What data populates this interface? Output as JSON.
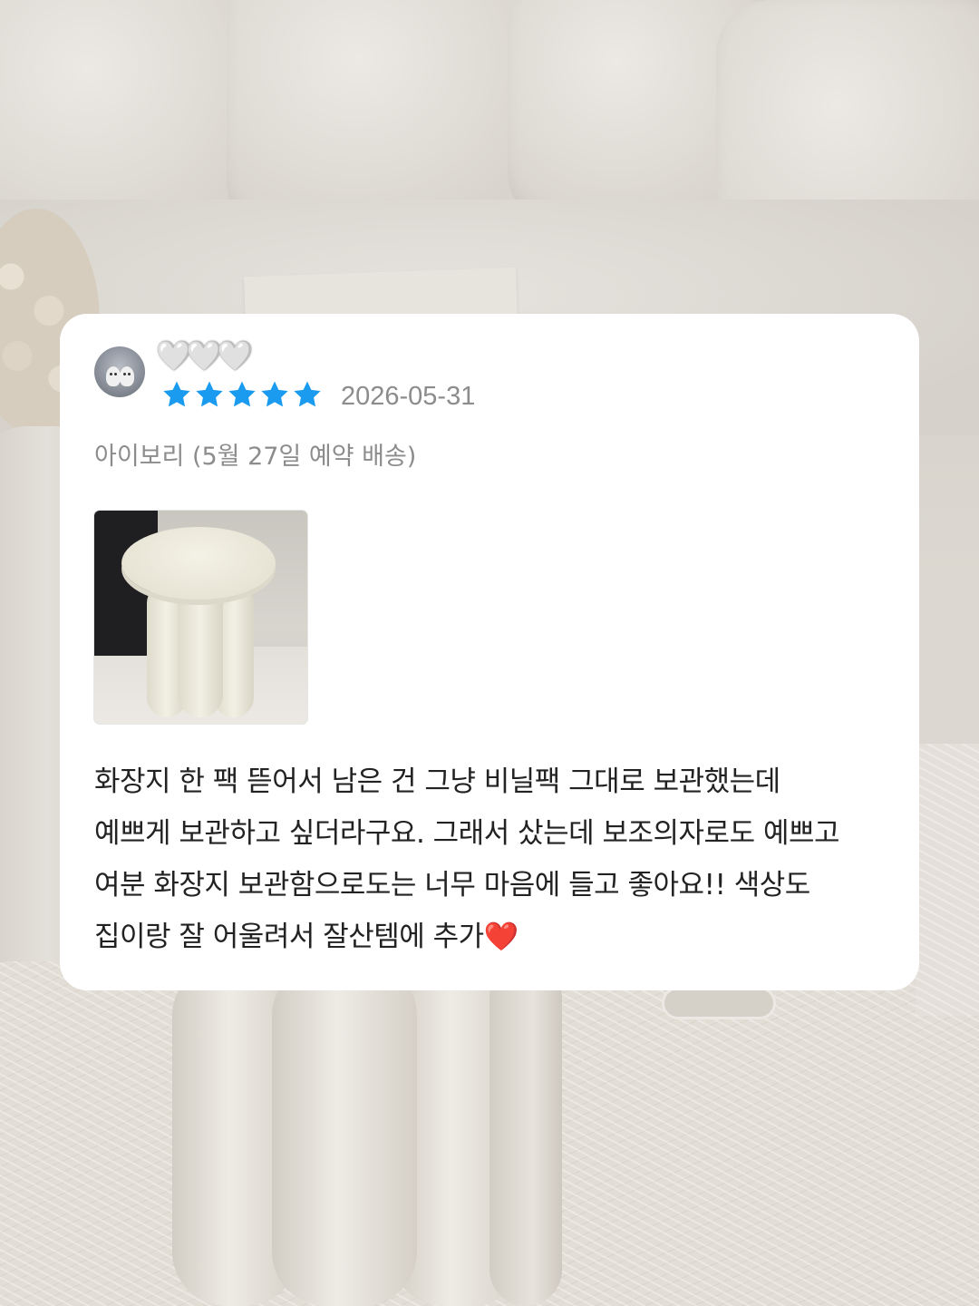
{
  "review": {
    "username": "🤍🤍🤍",
    "rating": 5,
    "rating_max": 5,
    "star_color": "#1a9bf0",
    "date": "2026-05-31",
    "option": "아이보리 (5월 27일 예약 배송)",
    "photo_alt": "stool-photo",
    "text": "화장지 한 팩 뜯어서 남은 건 그냥 비닐팩 그대로 보관했는데\n예쁘게 보관하고 싶더라구요. 그래서 샀는데 보조의자로도 예쁘고\n여분 화장지 보관함으로도는 너무 마음에 들고 좋아요!! 색상도\n집이랑 잘 어울려서 잘산템에 추가❤️"
  }
}
